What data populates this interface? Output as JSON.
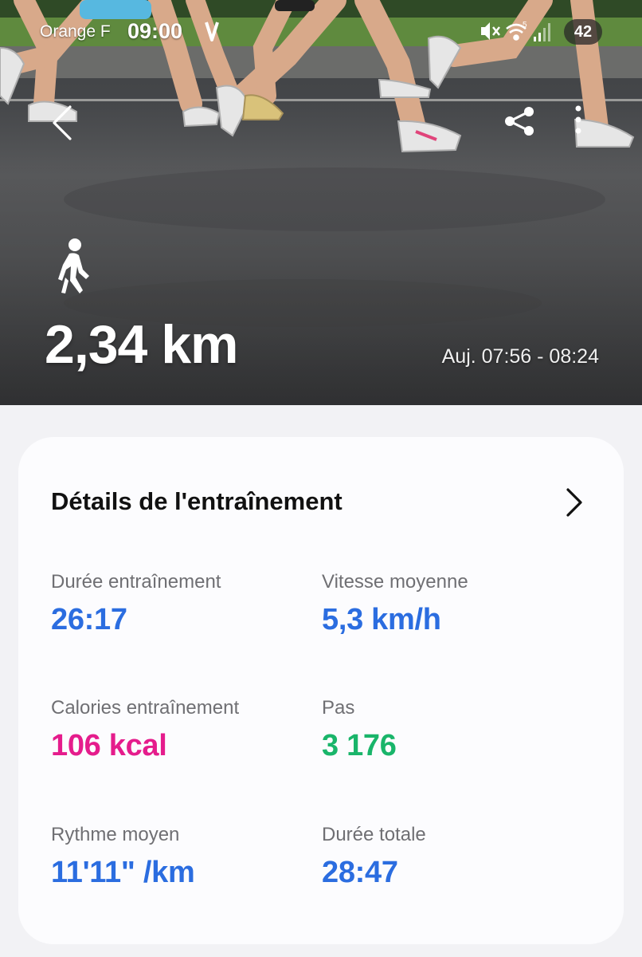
{
  "colors": {
    "blue": "#2b6de0",
    "pink": "#e51c8c",
    "green": "#19b56a"
  },
  "status_bar": {
    "carrier": "Orange F",
    "time": "09:00",
    "battery": "42",
    "icons": [
      "mute-icon",
      "wifi-icon",
      "signal-icon"
    ]
  },
  "header": {
    "back_icon": "chevron-left-icon",
    "share_icon": "share-icon",
    "more_icon": "more-vertical-icon"
  },
  "summary": {
    "activity_icon": "walking-person-icon",
    "distance": "2,34 km",
    "time_range": "Auj. 07:56 - 08:24"
  },
  "details": {
    "title": "Détails de l'entraînement",
    "stats": [
      {
        "label": "Durée entraînement",
        "value": "26:17",
        "color": "blue"
      },
      {
        "label": "Vitesse moyenne",
        "value": "5,3 km/h",
        "color": "blue"
      },
      {
        "label": "Calories entraînement",
        "value": "106 kcal",
        "color": "pink"
      },
      {
        "label": "Pas",
        "value": "3 176",
        "color": "green"
      },
      {
        "label": "Rythme moyen",
        "value": "11'11\" /km",
        "color": "blue"
      },
      {
        "label": "Durée totale",
        "value": "28:47",
        "color": "blue"
      }
    ]
  }
}
